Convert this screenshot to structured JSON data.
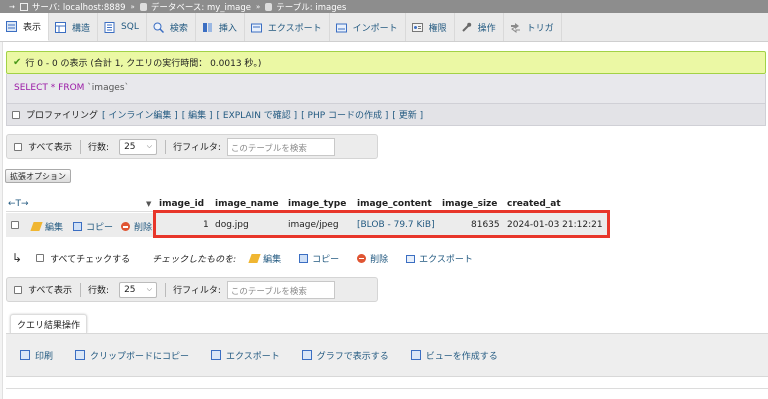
{
  "breadcrumb": {
    "server": "サーバ: localhost:8889",
    "database": "データベース: my_image",
    "table": "テーブル: images"
  },
  "tabs": [
    {
      "label": "表示",
      "icon": "browse-icon",
      "active": true
    },
    {
      "label": "構造",
      "icon": "structure-icon",
      "active": false
    },
    {
      "label": "SQL",
      "icon": "sql-icon",
      "active": false
    },
    {
      "label": "検索",
      "icon": "search-icon",
      "active": false
    },
    {
      "label": "挿入",
      "icon": "insert-icon",
      "active": false
    },
    {
      "label": "エクスポート",
      "icon": "export-icon",
      "active": false
    },
    {
      "label": "インポート",
      "icon": "import-icon",
      "active": false
    },
    {
      "label": "権限",
      "icon": "privileges-icon",
      "active": false
    },
    {
      "label": "操作",
      "icon": "wrench-icon",
      "active": false
    },
    {
      "label": "トリガ",
      "icon": "triggers-icon",
      "active": false
    }
  ],
  "success": {
    "message": "行 0 - 0 の表示 (合計 1, クエリの実行時間： 0.0013 秒。)"
  },
  "sql": {
    "keyword_select": "SELECT",
    "star": "*",
    "keyword_from": "FROM",
    "table": "`images`"
  },
  "profiling": {
    "label": "プロファイリング",
    "links": [
      "[ インライン編集 ]",
      "[ 編集 ]",
      "[ EXPLAIN で確認 ]",
      "[ PHP コードの作成 ]",
      "[ 更新 ]"
    ]
  },
  "nav": {
    "show_all": "すべて表示",
    "rows_label": "行数:",
    "rows_value": "25",
    "filter_label": "行フィルタ:",
    "filter_placeholder": "このテーブルを検索"
  },
  "options_button": "拡張オプション",
  "table": {
    "columns": [
      "image_id",
      "image_name",
      "image_type",
      "image_content",
      "image_size",
      "created_at"
    ],
    "row_actions": {
      "edit": "編集",
      "copy": "コピー",
      "delete": "削除"
    },
    "rows": [
      {
        "image_id": "1",
        "image_name": "dog.jpg",
        "image_type": "image/jpeg",
        "image_content": "[BLOB - 79.7 KiB]",
        "image_size": "81635",
        "created_at": "2024-01-03 21:12:21"
      }
    ]
  },
  "bulk": {
    "check_all": "すべてチェックする",
    "with_selected": "チェックしたものを:",
    "edit": "編集",
    "copy": "コピー",
    "delete": "削除",
    "export": "エクスポート"
  },
  "query_ops": {
    "title": "クエリ結果操作",
    "items": [
      "印刷",
      "クリップボードにコピー",
      "エクスポート",
      "グラフで表示する",
      "ビューを作成する"
    ]
  },
  "colors": {
    "highlight": "#e8362a",
    "link": "#235a81",
    "success_bg": "#ebf8a4"
  }
}
